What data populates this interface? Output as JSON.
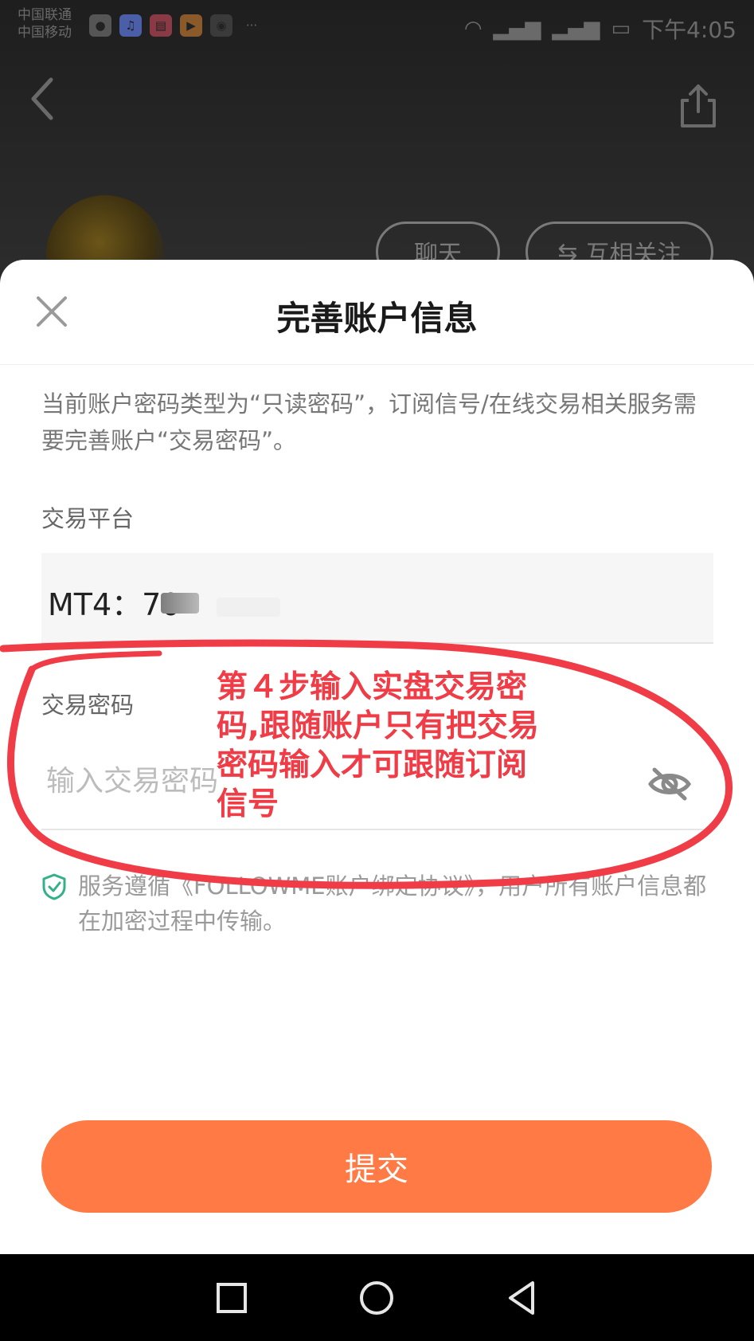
{
  "status_bar": {
    "carrier_line1": "中国联通",
    "carrier_line2": "中国移动",
    "time": "下午4:05"
  },
  "background": {
    "chat_label": "聊天",
    "follow_label": "互相关注"
  },
  "sheet": {
    "title": "完善账户信息",
    "notice": "当前账户密码类型为“只读密码”，订阅信号/在线交易相关服务需要完善账户“交易密码”。",
    "platform_label": "交易平台",
    "platform_value": "MT4：70",
    "password_label": "交易密码",
    "password_placeholder": "输入交易密码",
    "agreement": "服务遵循《FOLLOWME账户绑定协议》，用户所有账户信息都在加密过程中传输。",
    "submit_label": "提交"
  },
  "annotation": {
    "text": "第４步输入实盘交易密码,跟随账户只有把交易密码输入才可跟随订阅信号",
    "color": "#f03c46"
  },
  "colors": {
    "accent": "#ff7a45",
    "shield": "#33b08a"
  },
  "icons": [
    "back-icon",
    "share-icon",
    "close-icon",
    "eye-off-icon",
    "shield-check-icon",
    "nav-square-icon",
    "nav-circle-icon",
    "nav-triangle-icon"
  ]
}
